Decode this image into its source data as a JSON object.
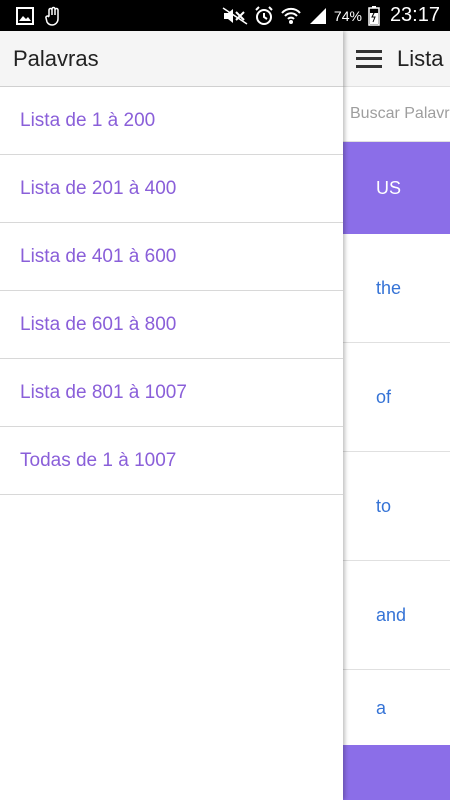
{
  "status_bar": {
    "battery_pct": "74%",
    "time": "23:17",
    "icons": [
      "image-icon",
      "hand-icon",
      "mute-icon",
      "alarm-icon",
      "wifi-icon",
      "signal-icon",
      "battery-icon"
    ]
  },
  "drawer": {
    "title": "Palavras",
    "items": [
      {
        "label": "Lista de 1 à 200"
      },
      {
        "label": "Lista de 201 à 400"
      },
      {
        "label": "Lista de 401 à 600"
      },
      {
        "label": "Lista de 601 à 800"
      },
      {
        "label": "Lista de 801 à 1007"
      },
      {
        "label": "Todas de 1 à 1007"
      }
    ]
  },
  "main": {
    "title": "Lista",
    "search": {
      "placeholder": "Buscar Palavra"
    },
    "list_header": "US",
    "words": [
      {
        "word": "the"
      },
      {
        "word": "of"
      },
      {
        "word": "to"
      },
      {
        "word": "and"
      },
      {
        "word": "a"
      }
    ]
  },
  "colors": {
    "accent": "#8b6ee8",
    "drawer_link": "#8a5fd9",
    "word_link": "#3573d6",
    "status_bar": "#000000"
  }
}
